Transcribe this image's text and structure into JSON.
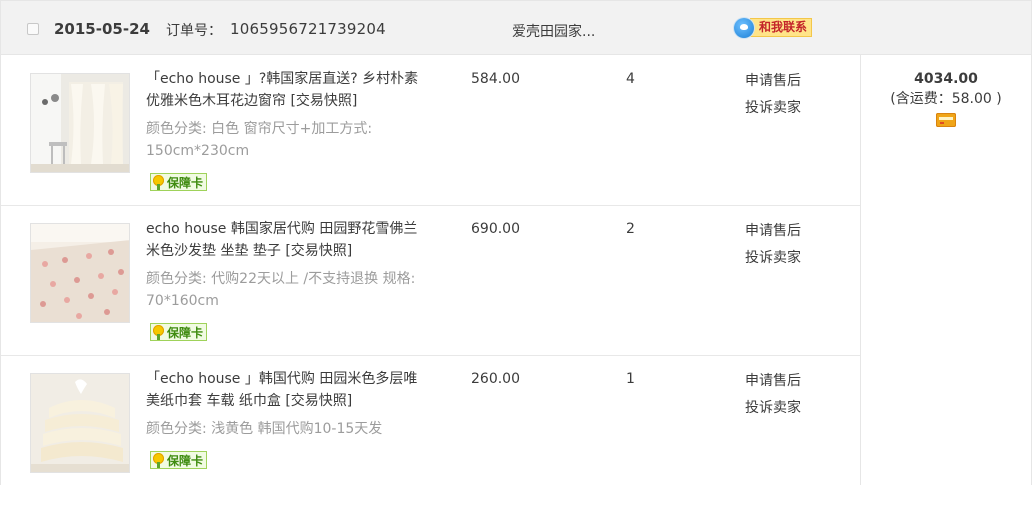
{
  "order": {
    "date": "2015-05-24",
    "number_label": "订单号：",
    "number": "1065956721739204",
    "shop": "爱壳田园家...",
    "contact": "和我联系",
    "total": "4034.00",
    "shipping": "(含运费：58.00 )"
  },
  "items": [
    {
      "title": "「echo house 」?韩国家居直送? 乡村朴素优雅米色木耳花边窗帘 [交易快照]",
      "sku_label": "颜色分类:",
      "sku_value": " 白色 窗帘尺寸+加工方式: 150cm*230cm",
      "badge": "保障卡",
      "price": "584.00",
      "qty": "4",
      "op1": "申请售后",
      "op2": "投诉卖家"
    },
    {
      "title": "echo house 韩国家居代购 田园野花雪佛兰米色沙发垫 坐垫 垫子 [交易快照]",
      "sku_label": "颜色分类:",
      "sku_value": " 代购22天以上 /不支持退换 规格: 70*160cm",
      "badge": "保障卡",
      "price": "690.00",
      "qty": "2",
      "op1": "申请售后",
      "op2": "投诉卖家"
    },
    {
      "title": "「echo house 」韩国代购 田园米色多层唯美纸巾套 车载 纸巾盒 [交易快照]",
      "sku_label": "颜色分类:",
      "sku_value": " 浅黄色 韩国代购10-15天发",
      "badge": "保障卡",
      "price": "260.00",
      "qty": "1",
      "op1": "申请售后",
      "op2": "投诉卖家"
    }
  ]
}
